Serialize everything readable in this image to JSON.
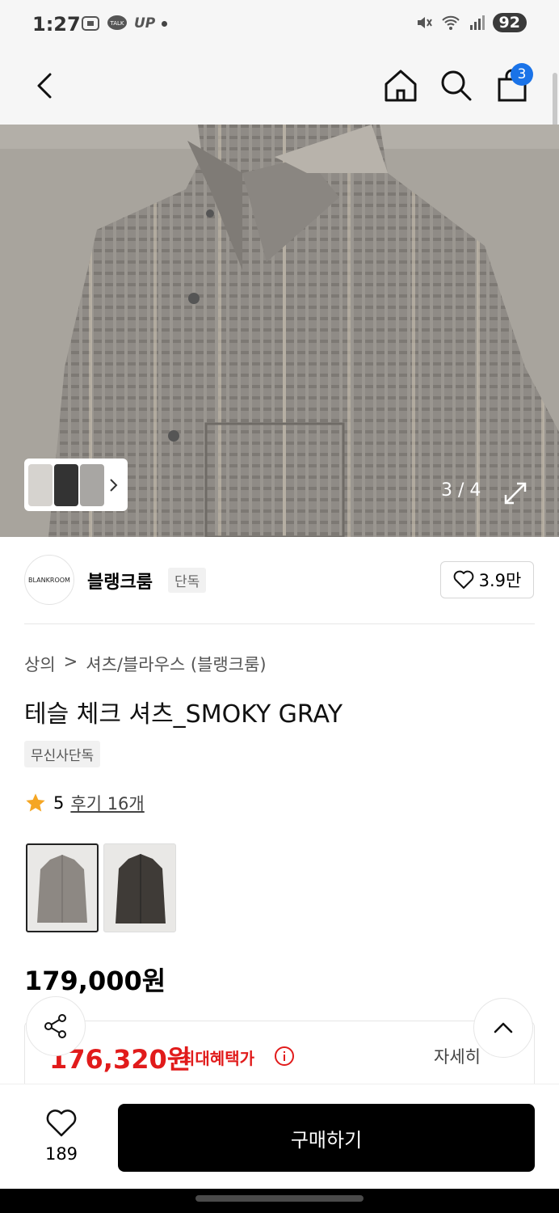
{
  "status": {
    "time": "1:27",
    "battery": "92",
    "up_label": "UP",
    "talk_label": "TALK"
  },
  "header": {
    "cart_count": "3"
  },
  "gallery": {
    "counter": "3 / 4"
  },
  "brand": {
    "logo_text": "BLANKROOM",
    "name": "블랭크룸",
    "tag": "단독",
    "likes": "3.9만"
  },
  "breadcrumb": {
    "level1": "상의",
    "separator": ">",
    "level2": "셔츠/블라우스 (블랭크룸)"
  },
  "product": {
    "title": "테슬 체크 셔츠_SMOKY GRAY",
    "exclusive_tag": "무신사단독",
    "rating": "5",
    "review_link": "후기 16개",
    "price": "179,000원",
    "variants": [
      {
        "name": "smoky-gray",
        "color": "#8d8883"
      },
      {
        "name": "charcoal",
        "color": "#3f3b37"
      }
    ]
  },
  "benefit": {
    "price": "176,320원",
    "label": "최대혜택가",
    "detail": "자세히"
  },
  "bottom": {
    "wish_count": "189",
    "buy_label": "구매하기"
  },
  "colors": {
    "accent_red": "#e11b1b",
    "badge_blue": "#1a73e8",
    "star": "#f5a623"
  }
}
